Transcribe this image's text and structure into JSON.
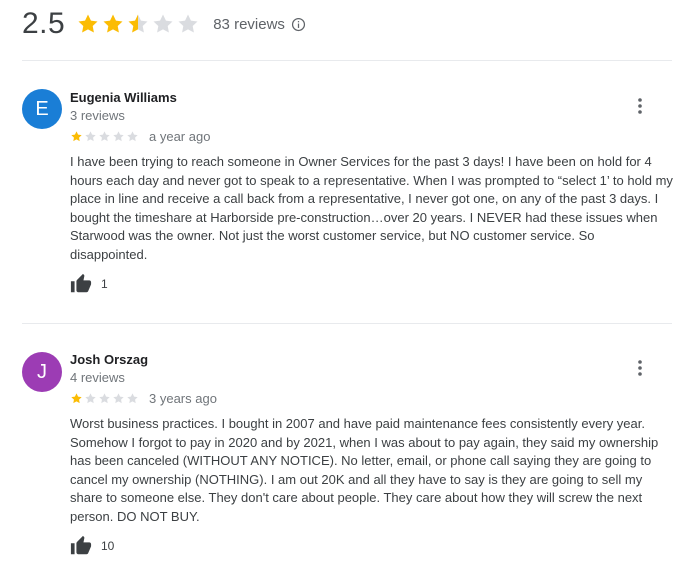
{
  "summary": {
    "rating": "2.5",
    "stars_value": 2.5,
    "stars_max": 5,
    "review_count": "83 reviews",
    "info_icon": "info-icon"
  },
  "colors": {
    "star_filled": "#fbbc04",
    "star_empty": "#dadce0",
    "avatar_e": "#1a7ed6",
    "avatar_j": "#9c3cb4"
  },
  "reviews": [
    {
      "initial": "E",
      "name": "Eugenia Williams",
      "meta": "3 reviews",
      "rating": 1,
      "date": "a year ago",
      "text": "I have been trying to reach someone in Owner Services for the past 3 days! I have been on hold for 4 hours each day and never got to speak to a representative. When I was prompted to “select 1’ to hold my place in line and receive a call back from a representative, I never got one, on any of the past 3 days. I bought the timeshare at Harborside pre-construction…over 20 years. I NEVER had these issues when Starwood was the owner. Not just the worst customer service, but NO customer service. So disappointed.",
      "likes": "1"
    },
    {
      "initial": "J",
      "name": "Josh Orszag",
      "meta": "4 reviews",
      "rating": 1,
      "date": "3 years ago",
      "text": "Worst business practices. I bought in 2007 and have paid maintenance fees consistently every year. Somehow I forgot to pay in 2020 and by 2021, when I was about to pay again, they said my ownership has been canceled (WITHOUT ANY NOTICE). No letter, email, or phone call saying they are going to cancel my ownership (NOTHING). I am out 20K and all they have to say is they are going to sell my share to someone else. They don't care about people. They care about how they will screw the next person. DO NOT BUY.",
      "likes": "10"
    }
  ]
}
